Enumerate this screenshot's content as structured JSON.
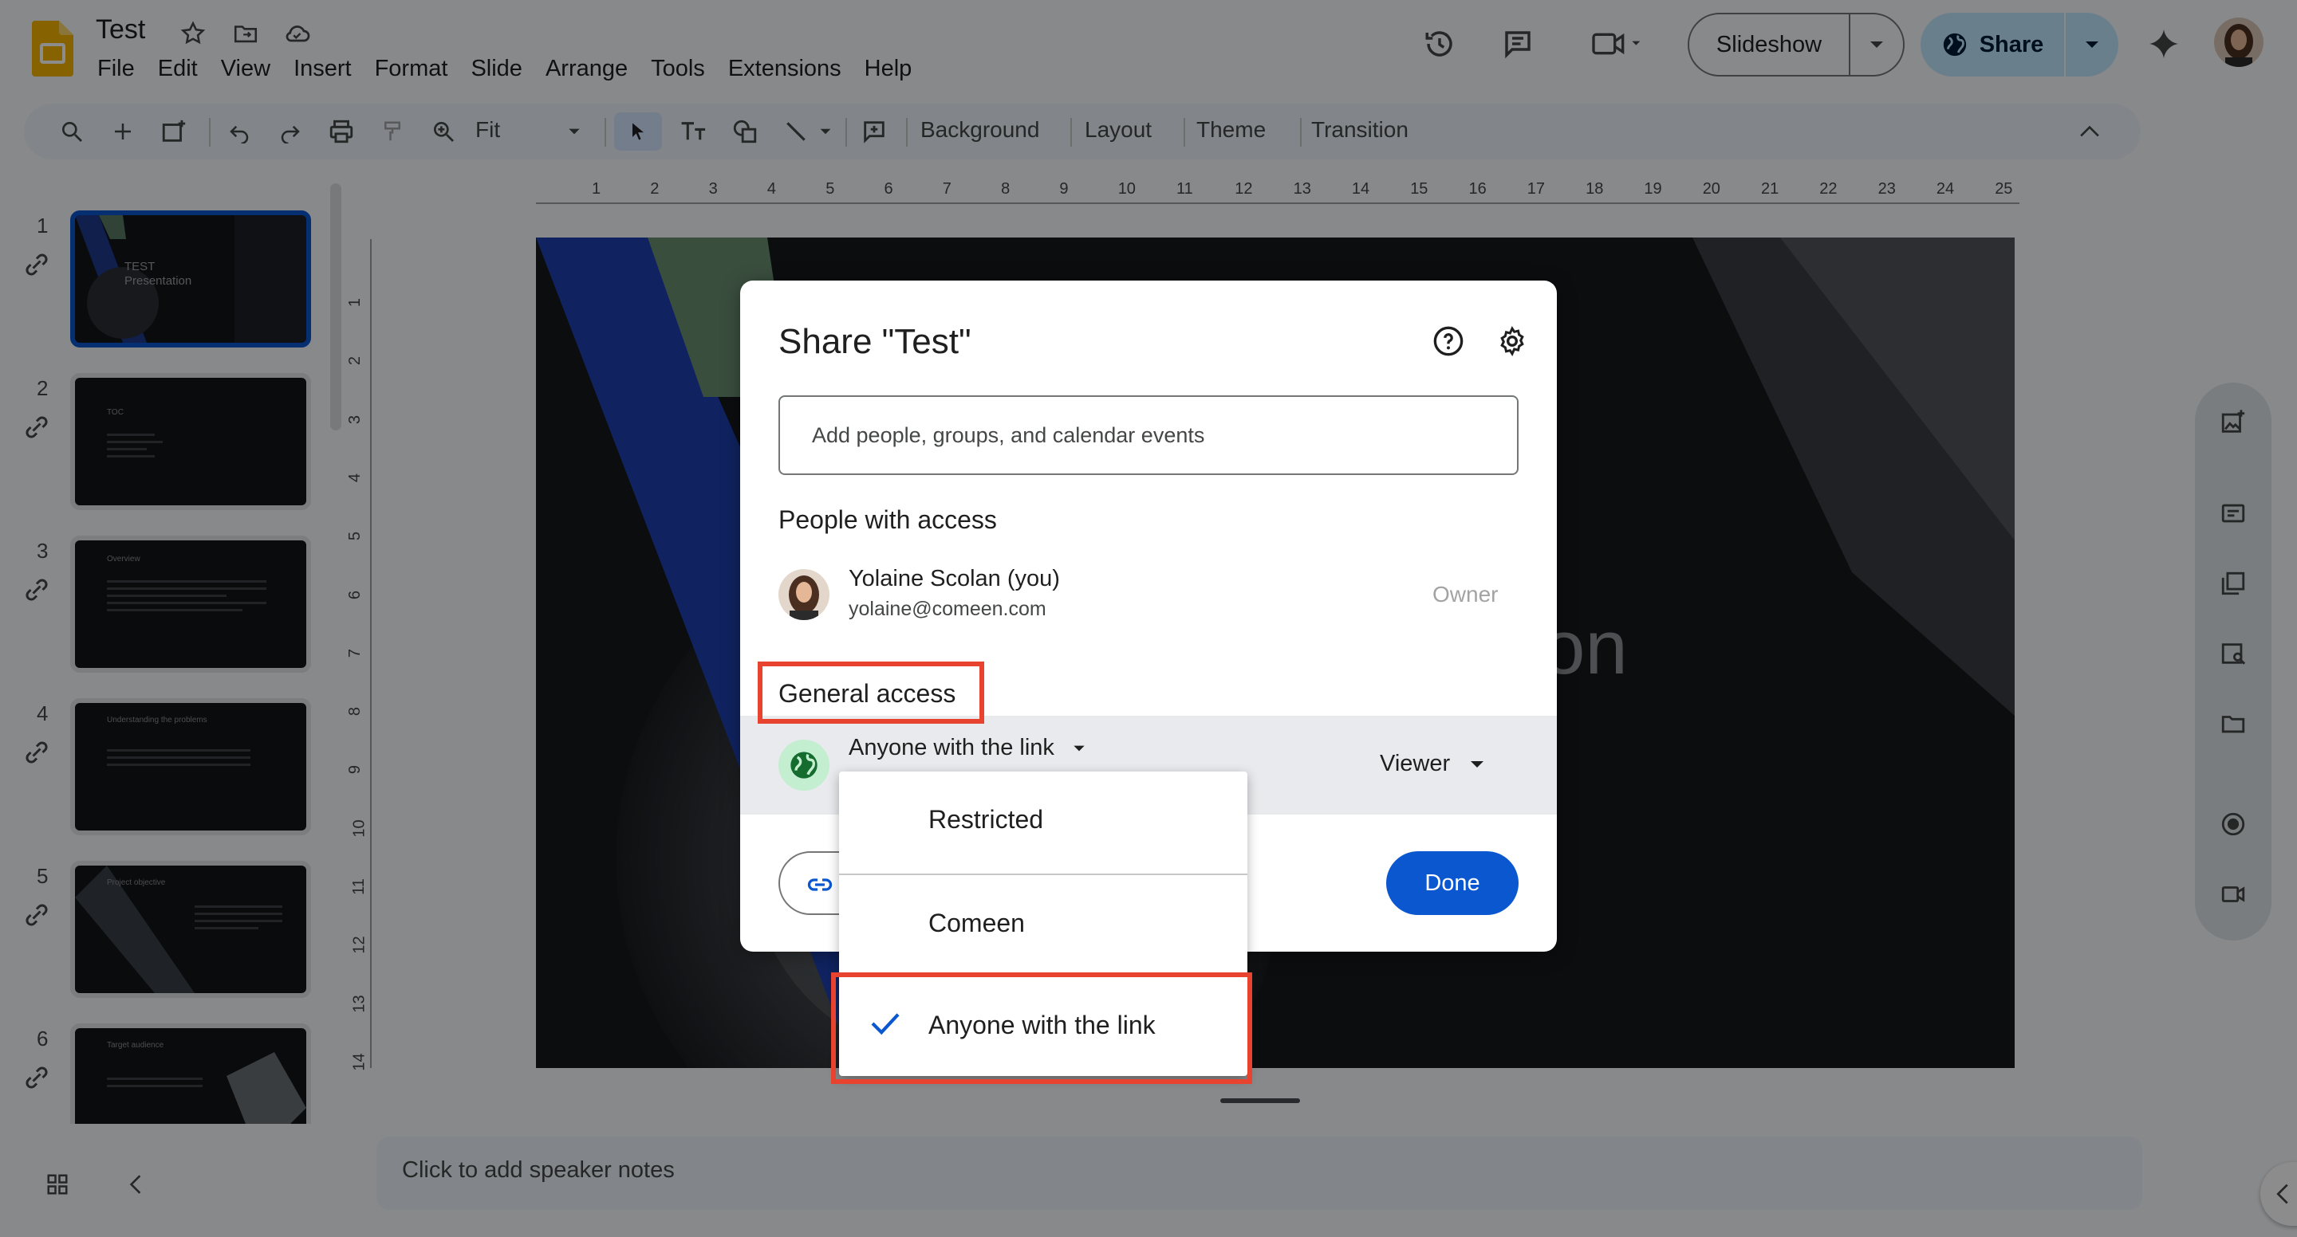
{
  "app": {
    "doc_title": "Test",
    "menu": [
      "File",
      "Edit",
      "View",
      "Insert",
      "Format",
      "Slide",
      "Arrange",
      "Tools",
      "Extensions",
      "Help"
    ],
    "slideshow_label": "Slideshow",
    "share_label": "Share"
  },
  "toolbar": {
    "zoom_value": "Fit",
    "background_label": "Background",
    "layout_label": "Layout",
    "theme_label": "Theme",
    "transition_label": "Transition"
  },
  "rulers": {
    "horizontal": [
      "1",
      "2",
      "3",
      "4",
      "5",
      "6",
      "7",
      "8",
      "9",
      "10",
      "11",
      "12",
      "13",
      "14",
      "15",
      "16",
      "17",
      "18",
      "19",
      "20",
      "21",
      "22",
      "23",
      "24",
      "25"
    ],
    "vertical": [
      "1",
      "2",
      "3",
      "4",
      "5",
      "6",
      "7",
      "8",
      "9",
      "10",
      "11",
      "12",
      "13",
      "14"
    ]
  },
  "slides": [
    {
      "number": "1",
      "title": "TEST",
      "subtitle": "Presentation"
    },
    {
      "number": "2",
      "title": "TOC"
    },
    {
      "number": "3",
      "title": "Overview"
    },
    {
      "number": "4",
      "title": "Understanding the problems"
    },
    {
      "number": "5",
      "title": "Project objective"
    },
    {
      "number": "6",
      "title": "Target audience"
    }
  ],
  "slide_canvas": {
    "visible_text": "on"
  },
  "notes": {
    "placeholder": "Click to add speaker notes"
  },
  "share_dialog": {
    "title": "Share \"Test\"",
    "input_placeholder": "Add people, groups, and calendar events",
    "people_heading": "People with access",
    "person": {
      "name": "Yolaine Scolan (you)",
      "email": "yolaine@comeen.com",
      "role": "Owner"
    },
    "general_access_heading": "General access",
    "general_access_value": "Anyone with the link",
    "role_value": "Viewer",
    "done_label": "Done"
  },
  "access_dropdown": {
    "options": [
      "Restricted",
      "Comeen",
      "Anyone with the link"
    ],
    "selected": "Anyone with the link"
  },
  "colors": {
    "accent": "#0b57d0",
    "share_bg": "#c2e7ff",
    "highlight_red": "#e8432f",
    "globe_bg": "#c4eed0"
  }
}
